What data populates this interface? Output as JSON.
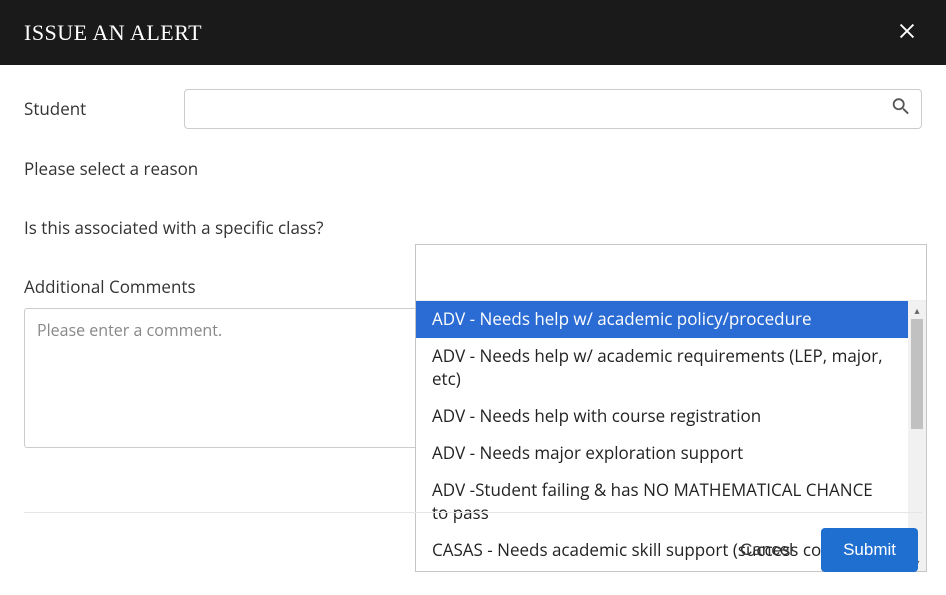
{
  "title": "ISSUE AN ALERT",
  "labels": {
    "student": "Student",
    "reason": "Please select a reason",
    "class": "Is this associated with a specific class?",
    "comments": "Additional Comments",
    "comments_placeholder": "Please enter a comment."
  },
  "student_value": "",
  "reason_options": [
    "ADV - Needs help w/ academic policy/procedure",
    "ADV - Needs help w/ academic requirements (LEP, major, etc)",
    "ADV - Needs help with course registration",
    "ADV - Needs major exploration support",
    "ADV -Student failing & has NO MATHEMATICAL CHANCE to pass",
    "CASAS - Needs academic skill support (success coaching)"
  ],
  "selected_reason_index": 0,
  "footer": {
    "cancel": "Cancel",
    "submit": "Submit"
  },
  "colors": {
    "primary": "#1f6fd1",
    "option_selected": "#2b6cd4",
    "titlebar": "#1a1a1a"
  }
}
